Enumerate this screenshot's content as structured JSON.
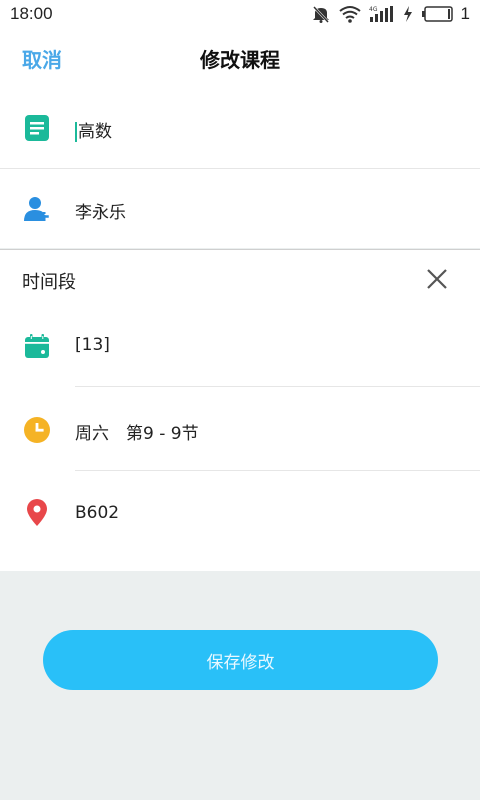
{
  "status_bar": {
    "time": "18:00",
    "battery_text": "1",
    "icons": [
      "mute-bell-icon",
      "wifi-icon",
      "signal-4g-icon",
      "charging-icon",
      "battery-icon"
    ]
  },
  "nav": {
    "cancel_label": "取消",
    "title": "修改课程"
  },
  "course": {
    "name": "高数",
    "teacher": "李永乐"
  },
  "time_section": {
    "title": "时间段",
    "weeks": "[13]",
    "time": "周六　第9 - 9节",
    "location": "B602"
  },
  "save_label": "保存修改",
  "colors": {
    "accent": "#4aa8e8",
    "teal": "#1bb99a",
    "orange": "#f5b325",
    "red": "#e8474a",
    "button": "#29c0f8"
  }
}
